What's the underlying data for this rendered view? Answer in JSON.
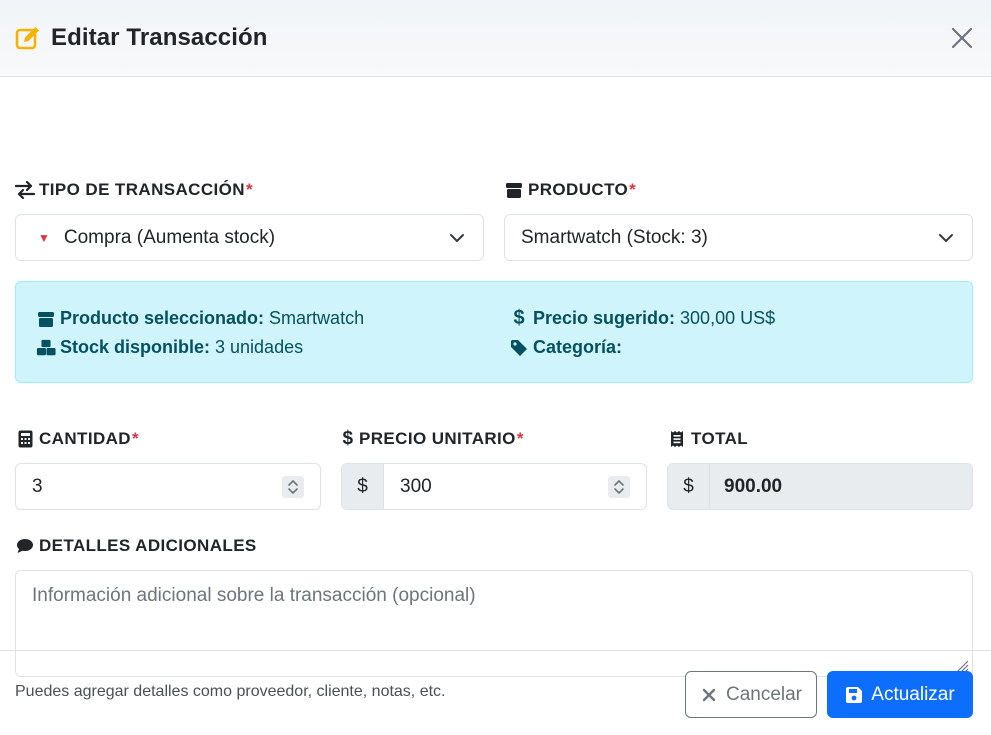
{
  "header": {
    "title": "Editar Transacción",
    "title_icon": "pencil-square-icon",
    "close_icon": "close-icon"
  },
  "tipo": {
    "label": "TIPO DE TRANSACCIÓN",
    "required_mark": "*",
    "icon": "arrows-exchange-icon",
    "selected_marker": "▼",
    "selected": "Compra (Aumenta stock)"
  },
  "producto": {
    "label": "PRODUCTO",
    "required_mark": "*",
    "icon": "box-icon",
    "selected": "Smartwatch (Stock: 3)"
  },
  "info": {
    "producto_label": "Producto seleccionado:",
    "producto_value": "Smartwatch",
    "stock_label": "Stock disponible:",
    "stock_value": "3 unidades",
    "precio_label": "Precio sugerido:",
    "precio_value": "300,00 US$",
    "categoria_label": "Categoría:",
    "categoria_value": ""
  },
  "cantidad": {
    "label": "CANTIDAD",
    "required_mark": "*",
    "icon": "calculator-icon",
    "value": "3"
  },
  "precio": {
    "label": "PRECIO UNITARIO",
    "required_mark": "*",
    "icon": "dollar-icon",
    "prefix": "$",
    "value": "300"
  },
  "total": {
    "label": "TOTAL",
    "icon": "receipt-icon",
    "prefix": "$",
    "value": "900.00"
  },
  "detalles": {
    "label": "DETALLES ADICIONALES",
    "icon": "comment-icon",
    "placeholder": "Información adicional sobre la transacción (opcional)",
    "help": "Puedes agregar detalles como proveedor, cliente, notas, etc."
  },
  "footer": {
    "cancel_label": "Cancelar",
    "update_label": "Actualizar"
  },
  "colors": {
    "primary": "#0d6efd",
    "required": "#dc3545",
    "info_bg": "#cff4fc",
    "info_text": "#055160",
    "title_icon": "#f5b400"
  }
}
